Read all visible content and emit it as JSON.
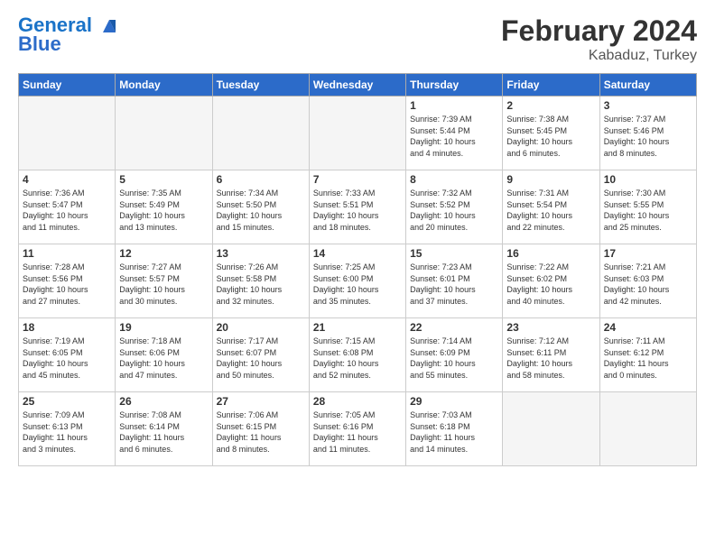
{
  "header": {
    "logo_line1": "General",
    "logo_line2": "Blue",
    "main_title": "February 2024",
    "sub_title": "Kabaduz, Turkey"
  },
  "weekdays": [
    "Sunday",
    "Monday",
    "Tuesday",
    "Wednesday",
    "Thursday",
    "Friday",
    "Saturday"
  ],
  "weeks": [
    [
      {
        "day": "",
        "info": ""
      },
      {
        "day": "",
        "info": ""
      },
      {
        "day": "",
        "info": ""
      },
      {
        "day": "",
        "info": ""
      },
      {
        "day": "1",
        "info": "Sunrise: 7:39 AM\nSunset: 5:44 PM\nDaylight: 10 hours\nand 4 minutes."
      },
      {
        "day": "2",
        "info": "Sunrise: 7:38 AM\nSunset: 5:45 PM\nDaylight: 10 hours\nand 6 minutes."
      },
      {
        "day": "3",
        "info": "Sunrise: 7:37 AM\nSunset: 5:46 PM\nDaylight: 10 hours\nand 8 minutes."
      }
    ],
    [
      {
        "day": "4",
        "info": "Sunrise: 7:36 AM\nSunset: 5:47 PM\nDaylight: 10 hours\nand 11 minutes."
      },
      {
        "day": "5",
        "info": "Sunrise: 7:35 AM\nSunset: 5:49 PM\nDaylight: 10 hours\nand 13 minutes."
      },
      {
        "day": "6",
        "info": "Sunrise: 7:34 AM\nSunset: 5:50 PM\nDaylight: 10 hours\nand 15 minutes."
      },
      {
        "day": "7",
        "info": "Sunrise: 7:33 AM\nSunset: 5:51 PM\nDaylight: 10 hours\nand 18 minutes."
      },
      {
        "day": "8",
        "info": "Sunrise: 7:32 AM\nSunset: 5:52 PM\nDaylight: 10 hours\nand 20 minutes."
      },
      {
        "day": "9",
        "info": "Sunrise: 7:31 AM\nSunset: 5:54 PM\nDaylight: 10 hours\nand 22 minutes."
      },
      {
        "day": "10",
        "info": "Sunrise: 7:30 AM\nSunset: 5:55 PM\nDaylight: 10 hours\nand 25 minutes."
      }
    ],
    [
      {
        "day": "11",
        "info": "Sunrise: 7:28 AM\nSunset: 5:56 PM\nDaylight: 10 hours\nand 27 minutes."
      },
      {
        "day": "12",
        "info": "Sunrise: 7:27 AM\nSunset: 5:57 PM\nDaylight: 10 hours\nand 30 minutes."
      },
      {
        "day": "13",
        "info": "Sunrise: 7:26 AM\nSunset: 5:58 PM\nDaylight: 10 hours\nand 32 minutes."
      },
      {
        "day": "14",
        "info": "Sunrise: 7:25 AM\nSunset: 6:00 PM\nDaylight: 10 hours\nand 35 minutes."
      },
      {
        "day": "15",
        "info": "Sunrise: 7:23 AM\nSunset: 6:01 PM\nDaylight: 10 hours\nand 37 minutes."
      },
      {
        "day": "16",
        "info": "Sunrise: 7:22 AM\nSunset: 6:02 PM\nDaylight: 10 hours\nand 40 minutes."
      },
      {
        "day": "17",
        "info": "Sunrise: 7:21 AM\nSunset: 6:03 PM\nDaylight: 10 hours\nand 42 minutes."
      }
    ],
    [
      {
        "day": "18",
        "info": "Sunrise: 7:19 AM\nSunset: 6:05 PM\nDaylight: 10 hours\nand 45 minutes."
      },
      {
        "day": "19",
        "info": "Sunrise: 7:18 AM\nSunset: 6:06 PM\nDaylight: 10 hours\nand 47 minutes."
      },
      {
        "day": "20",
        "info": "Sunrise: 7:17 AM\nSunset: 6:07 PM\nDaylight: 10 hours\nand 50 minutes."
      },
      {
        "day": "21",
        "info": "Sunrise: 7:15 AM\nSunset: 6:08 PM\nDaylight: 10 hours\nand 52 minutes."
      },
      {
        "day": "22",
        "info": "Sunrise: 7:14 AM\nSunset: 6:09 PM\nDaylight: 10 hours\nand 55 minutes."
      },
      {
        "day": "23",
        "info": "Sunrise: 7:12 AM\nSunset: 6:11 PM\nDaylight: 10 hours\nand 58 minutes."
      },
      {
        "day": "24",
        "info": "Sunrise: 7:11 AM\nSunset: 6:12 PM\nDaylight: 11 hours\nand 0 minutes."
      }
    ],
    [
      {
        "day": "25",
        "info": "Sunrise: 7:09 AM\nSunset: 6:13 PM\nDaylight: 11 hours\nand 3 minutes."
      },
      {
        "day": "26",
        "info": "Sunrise: 7:08 AM\nSunset: 6:14 PM\nDaylight: 11 hours\nand 6 minutes."
      },
      {
        "day": "27",
        "info": "Sunrise: 7:06 AM\nSunset: 6:15 PM\nDaylight: 11 hours\nand 8 minutes."
      },
      {
        "day": "28",
        "info": "Sunrise: 7:05 AM\nSunset: 6:16 PM\nDaylight: 11 hours\nand 11 minutes."
      },
      {
        "day": "29",
        "info": "Sunrise: 7:03 AM\nSunset: 6:18 PM\nDaylight: 11 hours\nand 14 minutes."
      },
      {
        "day": "",
        "info": ""
      },
      {
        "day": "",
        "info": ""
      }
    ]
  ]
}
